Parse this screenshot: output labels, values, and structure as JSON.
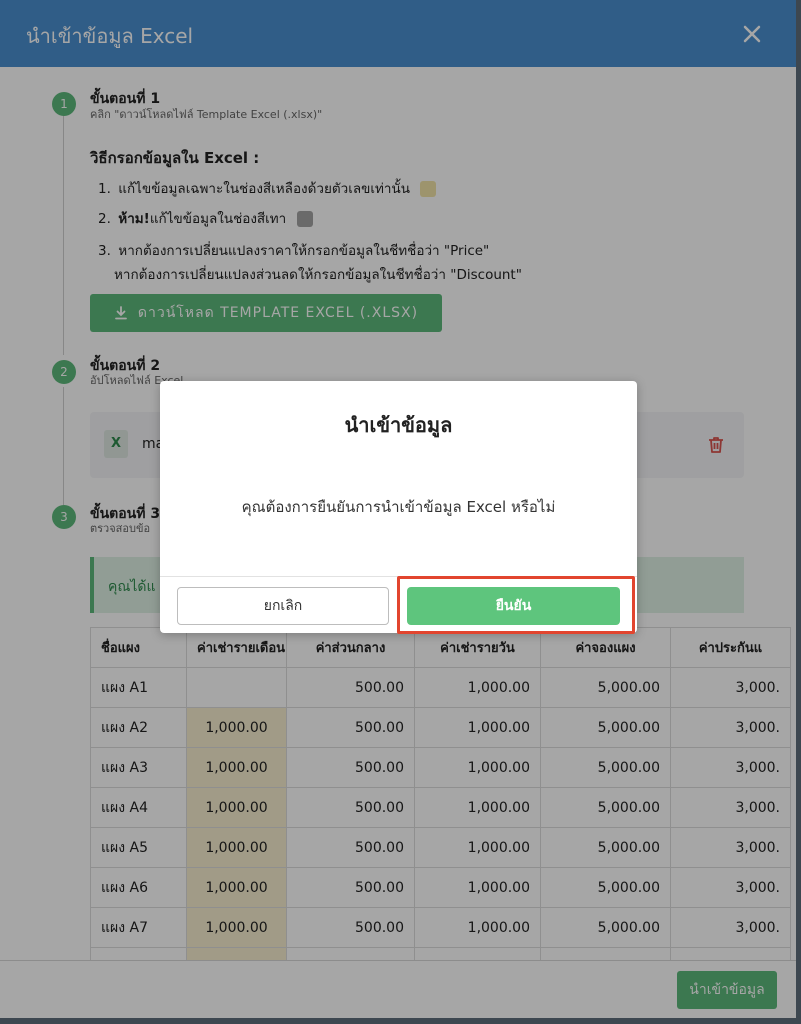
{
  "modal": {
    "title": "นำเข้าข้อมูล Excel",
    "close_icon": "close-icon"
  },
  "step1": {
    "number": "1",
    "title": "ขั้นตอนที่ 1",
    "subtitle": "คลิก \"ดาวน์โหลดไฟล์ Template Excel (.xlsx)\""
  },
  "instructions": {
    "title": "วิธีกรอกข้อมูลใน Excel :",
    "item1": {
      "num": "1.",
      "text": "แก้ไขข้อมูลเฉพาะในช่องสีเหลืองด้วยตัวเลขเท่านั้น"
    },
    "item2": {
      "num": "2.",
      "bold": "ห้าม!",
      "text": "แก้ไขข้อมูลในช่องสีเทา"
    },
    "item3": {
      "num": "3.",
      "line1": "หากต้องการเปลี่ยนแปลงราคาให้กรอกข้อมูลในชีทชื่อว่า \"Price\"",
      "line2": "หากต้องการเปลี่ยนแปลงส่วนลดให้กรอกข้อมูลในชีทชื่อว่า \"Discount\""
    },
    "colors": {
      "yellow": "#f1e3a8",
      "gray": "#a3a3a3"
    }
  },
  "download_button": {
    "label": "ดาวน์โหลด TEMPLATE EXCEL (.XLSX)",
    "icon": "download-icon"
  },
  "step2": {
    "number": "2",
    "title": "ขั้นตอนที่ 2",
    "subtitle": "อัปโหลดไฟล์ Excel"
  },
  "file": {
    "icon_label": "X",
    "name": "ma",
    "delete_icon": "trash-icon"
  },
  "step3": {
    "number": "3",
    "title": "ขั้นตอนที่ 3",
    "subtitle": "ตรวจสอบข้อ"
  },
  "alert": {
    "text": "คุณได้แ"
  },
  "table": {
    "headers": [
      "ชื่อแผง",
      "ค่าเช่ารายเดือน",
      "ค่าส่วนกลาง",
      "ค่าเช่ารายวัน",
      "ค่าจองแผง",
      "ค่าประกันแ"
    ],
    "rows": [
      [
        "แผง A1",
        "",
        "500.00",
        "1,000.00",
        "5,000.00",
        "3,000."
      ],
      [
        "แผง A2",
        "1,000.00",
        "500.00",
        "1,000.00",
        "5,000.00",
        "3,000."
      ],
      [
        "แผง A3",
        "1,000.00",
        "500.00",
        "1,000.00",
        "5,000.00",
        "3,000."
      ],
      [
        "แผง A4",
        "1,000.00",
        "500.00",
        "1,000.00",
        "5,000.00",
        "3,000."
      ],
      [
        "แผง A5",
        "1,000.00",
        "500.00",
        "1,000.00",
        "5,000.00",
        "3,000."
      ],
      [
        "แผง A6",
        "1,000.00",
        "500.00",
        "1,000.00",
        "5,000.00",
        "3,000."
      ],
      [
        "แผง A7",
        "1,000.00",
        "500.00",
        "1,000.00",
        "5,000.00",
        "3,000."
      ]
    ]
  },
  "footer": {
    "import_label": "นำเข้าข้อมูล"
  },
  "dialog": {
    "title": "นำเข้าข้อมูล",
    "message": "คุณต้องการยืนยันการนำเข้าข้อมูล Excel หรือไม่",
    "cancel_label": "ยกเลิก",
    "confirm_label": "ยืนยัน",
    "accent_color": "#5ec57d",
    "highlight_color": "#e2452f"
  }
}
